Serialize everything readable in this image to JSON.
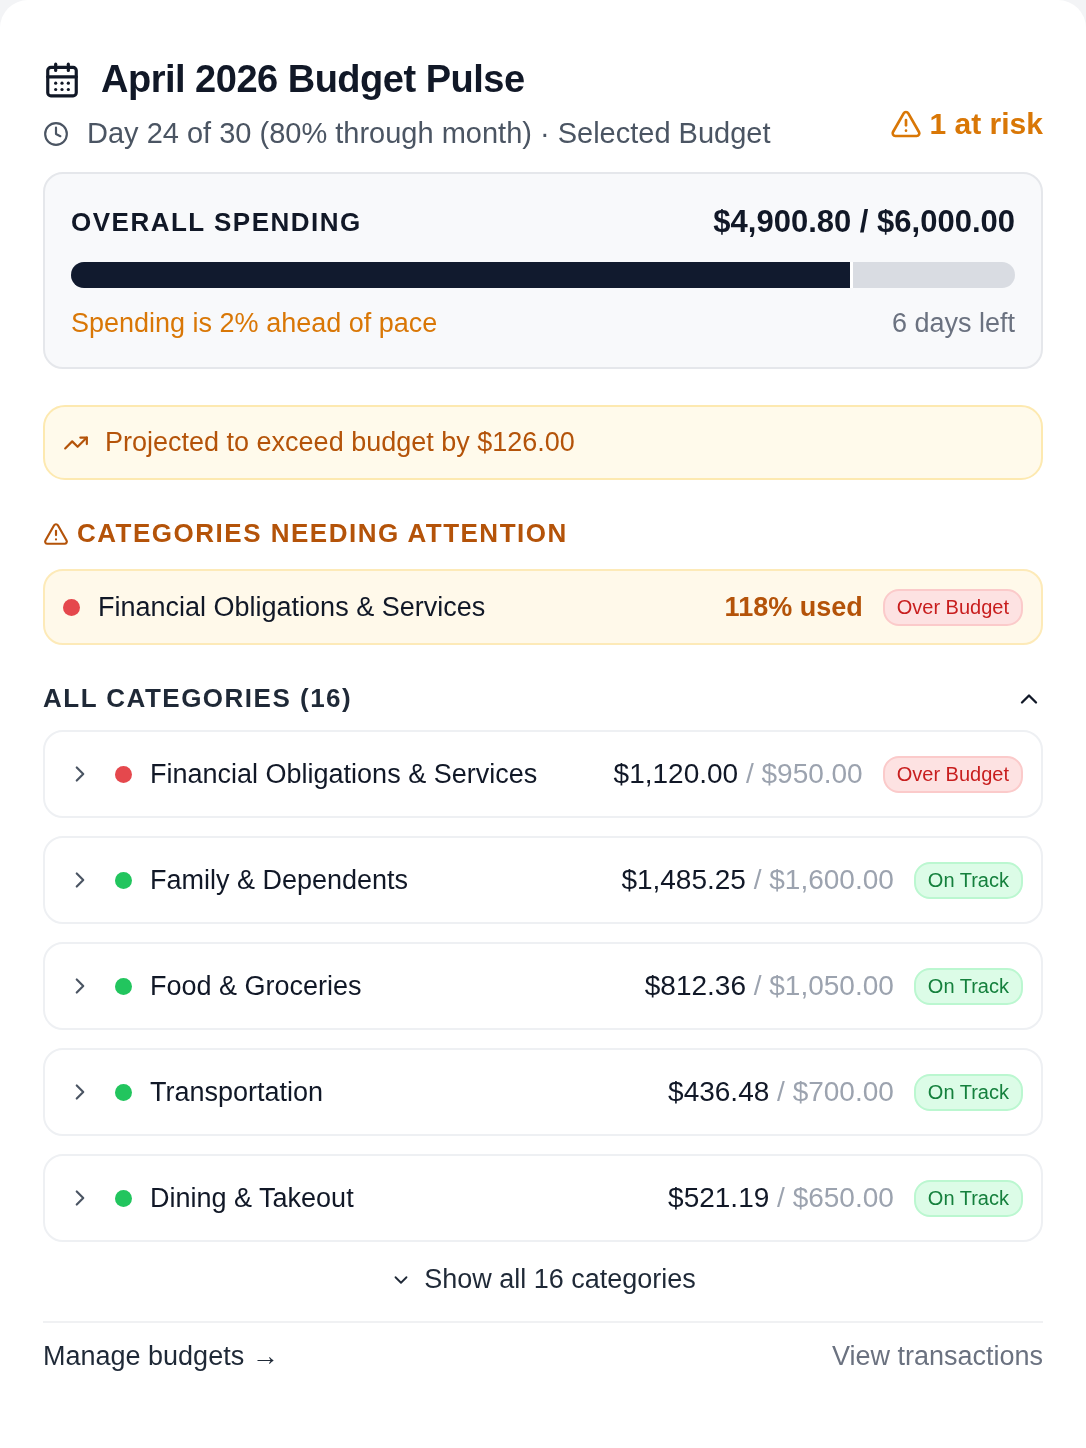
{
  "header": {
    "title": "April 2026 Budget Pulse",
    "subtitle": "Day 24 of 30 (80% through month) · Selected Budget",
    "risk": "1 at risk"
  },
  "overall": {
    "label": "OVERALL SPENDING",
    "amount": "$4,900.80 / $6,000.00",
    "level": 0.825,
    "pace": "Spending is 2% ahead of pace",
    "remaining": "6 days left"
  },
  "alert": {
    "text": "Projected to exceed budget by $126.00"
  },
  "attention": {
    "heading": "CATEGORIES NEEDING ATTENTION",
    "items": [
      {
        "name": "Financial Obligations & Services",
        "color": "#e5484d",
        "usage": "118% used",
        "kind": "over",
        "badge": "Over Budget"
      }
    ]
  },
  "categories": {
    "heading": "ALL CATEGORIES (16)",
    "expanded": true,
    "items": [
      {
        "name": "Financial Obligations & Services",
        "color": "#e5484d",
        "spent": "$1,120.00",
        "budget": "/ $950.00",
        "kind": "over",
        "badge": "Over Budget",
        "expanded": false
      },
      {
        "name": "Family & Dependents",
        "color": "#22c55e",
        "spent": "$1,485.25",
        "budget": "/ $1,600.00",
        "kind": "on_track",
        "badge": "On Track",
        "expanded": false
      },
      {
        "name": "Food & Groceries",
        "color": "#22c55e",
        "spent": "$812.36",
        "budget": "/ $1,050.00",
        "kind": "on_track",
        "badge": "On Track",
        "expanded": false
      },
      {
        "name": "Transportation",
        "color": "#22c55e",
        "spent": "$436.48",
        "budget": "/ $700.00",
        "kind": "on_track",
        "badge": "On Track",
        "expanded": false
      },
      {
        "name": "Dining & Takeout",
        "color": "#22c55e",
        "spent": "$521.19",
        "budget": "/ $650.00",
        "kind": "on_track",
        "badge": "On Track",
        "expanded": false
      }
    ]
  },
  "show_all": "Show all 16 categories",
  "footer": {
    "manage": "Manage budgets →",
    "transactions": "View transactions"
  }
}
